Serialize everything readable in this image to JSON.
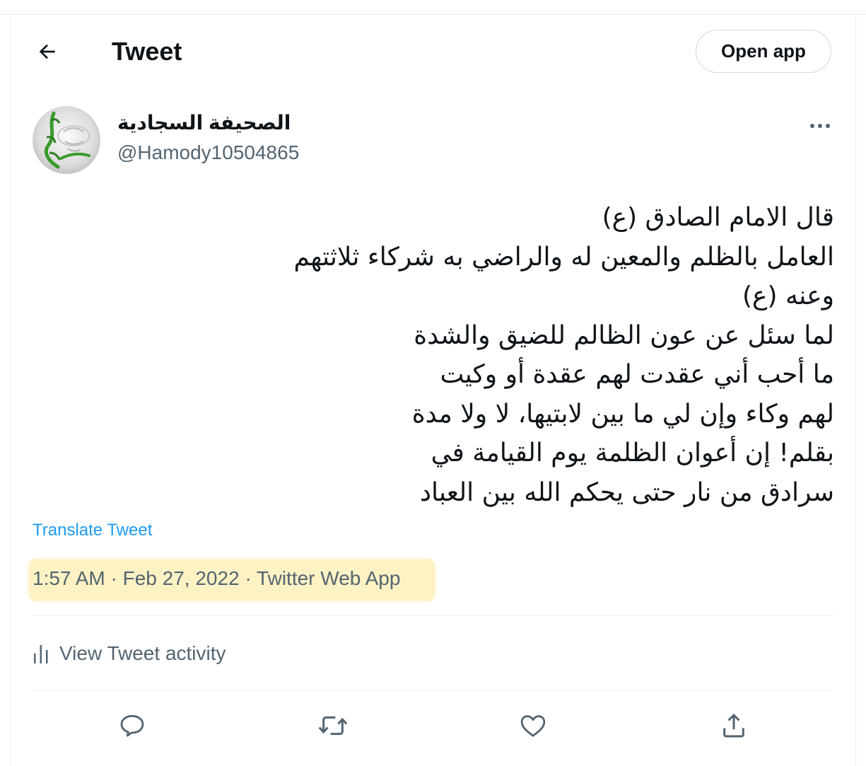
{
  "header": {
    "title": "Tweet",
    "open_app_label": "Open app",
    "back_icon": "arrow-left-icon"
  },
  "author": {
    "display_name": "الصحيفة السجادية",
    "handle": "@Hamody10504865"
  },
  "tweet": {
    "lines": [
      "قال الامام الصادق (ع)",
      "العامل بالظلم والمعين له والراضي به شركاء ثلاثتهم",
      "وعنه (ع)",
      "لما سئل عن عون الظالم للضيق والشدة",
      "ما أحب أني عقدت لهم عقدة أو وكيت",
      "لهم وكاء وإن لي ما بين لابتيها، لا ولا مدة",
      "بقلم! إن أعوان الظلمة يوم القيامة في",
      "سرادق من نار حتى يحكم الله بين العباد"
    ],
    "translate_label": "Translate Tweet",
    "time": "1:57 AM",
    "date": "Feb 27, 2022",
    "source": "Twitter Web App",
    "separator": "·"
  },
  "activity": {
    "label": "View Tweet activity"
  },
  "actions": [
    "reply-icon",
    "retweet-icon",
    "like-icon",
    "share-icon"
  ],
  "colors": {
    "link": "#1d9bf0",
    "secondary_text": "#536471",
    "highlight": "#fdf2c4",
    "avatar_leaf": "#3a9a2e"
  }
}
